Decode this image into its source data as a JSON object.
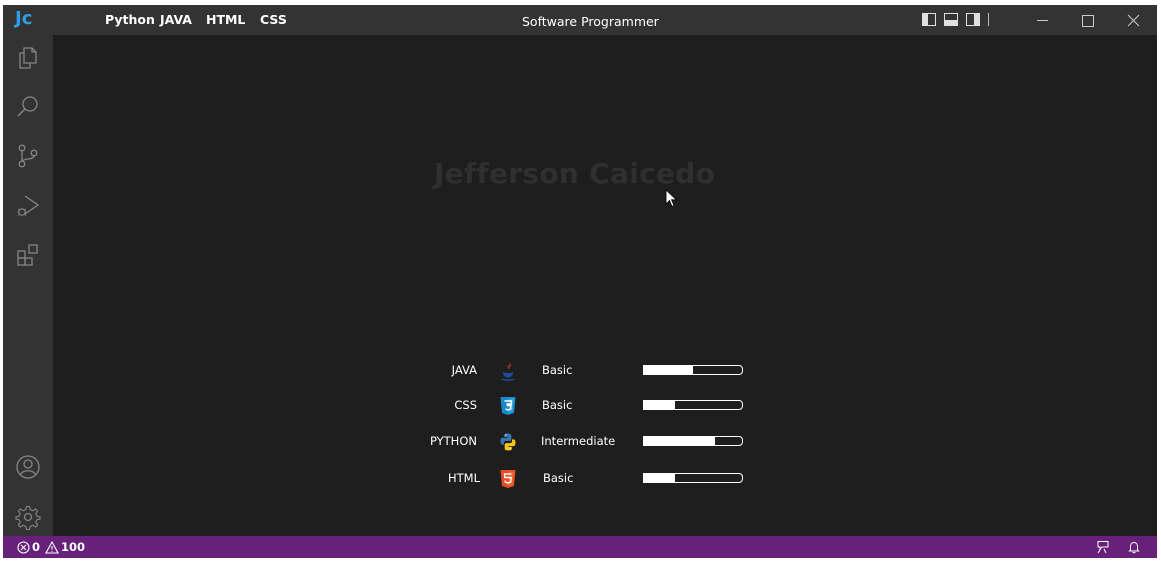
{
  "titlebar": {
    "logo": "Jc",
    "menu": [
      "Python",
      "JAVA",
      "HTML",
      "CSS"
    ],
    "title": "Software Programmer"
  },
  "hero": {
    "name": "Jefferson Caicedo"
  },
  "skills": [
    {
      "name": "JAVA",
      "icon": "java-icon",
      "level": "Basic",
      "progress": 0.5
    },
    {
      "name": "CSS",
      "icon": "css3-icon",
      "level": "Basic",
      "progress": 0.32
    },
    {
      "name": "PYTHON",
      "icon": "python-icon",
      "level": "Intermediate",
      "progress": 0.72
    },
    {
      "name": "HTML",
      "icon": "html5-icon",
      "level": "Basic",
      "progress": 0.32
    }
  ],
  "statusbar": {
    "errors": "0",
    "warnings": "100"
  },
  "colors": {
    "titlebar": "#333333",
    "activitybar": "#333333",
    "editor": "#1e1e1e",
    "statusbar": "#68217a",
    "logo": "#2f9ee8",
    "hero_text": "#2f2f2f"
  }
}
